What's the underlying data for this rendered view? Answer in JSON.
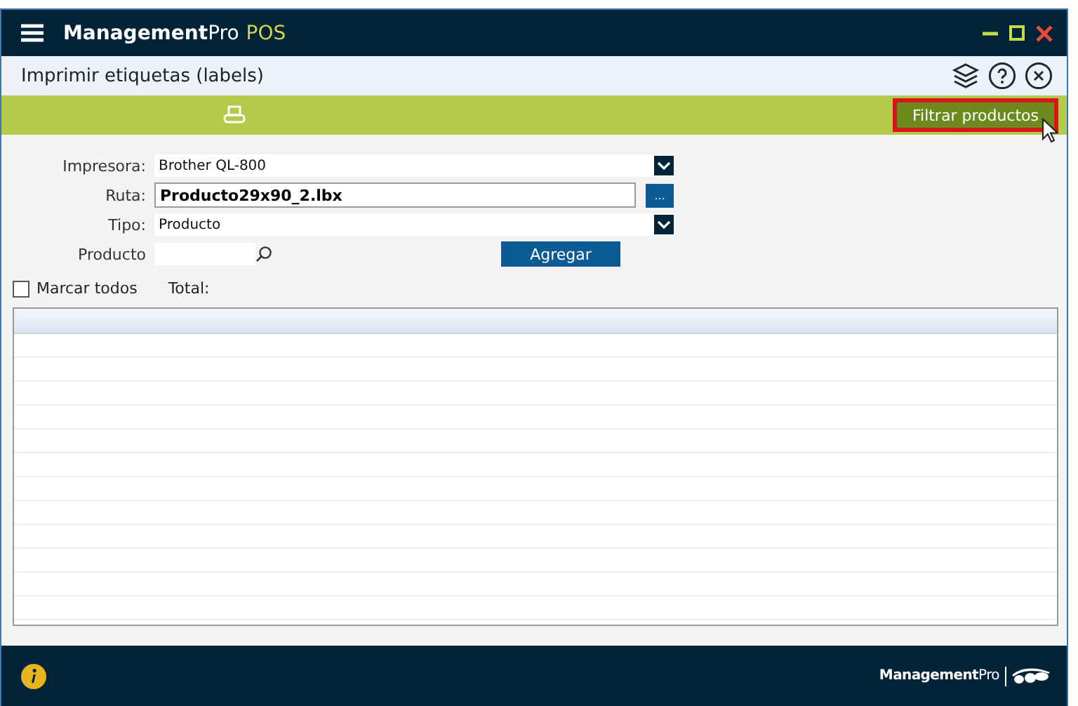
{
  "window": {
    "app_name": "**Management**Pro",
    "edition": "POS"
  },
  "header": {
    "title": "Imprimir etiquetas (labels)"
  },
  "toolbar": {
    "filter_button": {
      "label": "Filtrar productos",
      "highlighted": true
    }
  },
  "form": {
    "printer": {
      "label": "Impresora:",
      "value": "Brother QL-800"
    },
    "path": {
      "label": "Ruta:",
      "value": "Producto29x90_2.lbx",
      "browse": "..."
    },
    "type": {
      "label": "Tipo:",
      "value": "Producto"
    },
    "product": {
      "label": "Producto"
    },
    "add_button": "Agregar"
  },
  "select_all": {
    "label": "Marcar todos",
    "checked": false
  },
  "total": {
    "label": "Total:"
  },
  "footer": {
    "logo": "**Management**Pro"
  }
}
